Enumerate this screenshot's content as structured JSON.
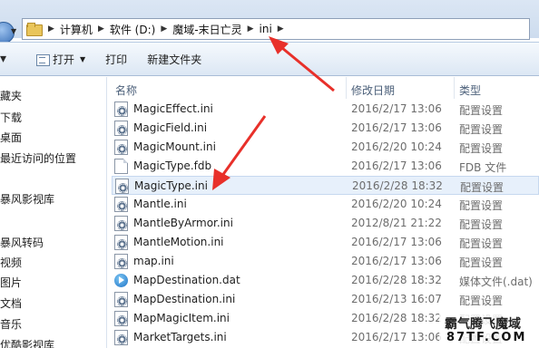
{
  "breadcrumb": {
    "items": [
      "计算机",
      "软件 (D:)",
      "魔域-末日亡灵",
      "ini"
    ]
  },
  "toolbar": {
    "open_label": "打开",
    "print_label": "打印",
    "new_folder_label": "新建文件夹"
  },
  "nav": {
    "items": [
      "藏夹",
      "下载",
      "桌面",
      "最近访问的位置",
      "",
      "暴风影视库",
      "暴风转码",
      "视频",
      "图片",
      "文档",
      "音乐",
      "优酷影视库"
    ]
  },
  "columns": {
    "name": "名称",
    "date": "修改日期",
    "type": "类型"
  },
  "files": [
    {
      "name": "MagicEffect.ini",
      "date": "2016/2/17 13:06",
      "type": "配置设置",
      "icon": "ini-file-icon"
    },
    {
      "name": "MagicField.ini",
      "date": "2016/2/17 13:06",
      "type": "配置设置",
      "icon": "ini-file-icon"
    },
    {
      "name": "MagicMount.ini",
      "date": "2016/2/20 10:24",
      "type": "配置设置",
      "icon": "ini-file-icon"
    },
    {
      "name": "MagicType.fdb",
      "date": "2016/2/17 13:06",
      "type": "FDB 文件",
      "icon": "document-icon"
    },
    {
      "name": "MagicType.ini",
      "date": "2016/2/28 18:32",
      "type": "配置设置",
      "icon": "ini-file-icon"
    },
    {
      "name": "Mantle.ini",
      "date": "2016/2/20 10:24",
      "type": "配置设置",
      "icon": "ini-file-icon"
    },
    {
      "name": "MantleByArmor.ini",
      "date": "2012/8/21 21:22",
      "type": "配置设置",
      "icon": "ini-file-icon"
    },
    {
      "name": "MantleMotion.ini",
      "date": "2016/2/17 13:06",
      "type": "配置设置",
      "icon": "ini-file-icon"
    },
    {
      "name": "map.ini",
      "date": "2016/2/17 13:06",
      "type": "配置设置",
      "icon": "ini-file-icon"
    },
    {
      "name": "MapDestination.dat",
      "date": "2016/2/28 18:32",
      "type": "媒体文件(.dat)",
      "icon": "media-file-icon"
    },
    {
      "name": "MapDestination.ini",
      "date": "2016/2/13 16:07",
      "type": "配置设置",
      "icon": "ini-file-icon"
    },
    {
      "name": "MapMagicItem.ini",
      "date": "2016/2/28 18:32",
      "type": "配置设置",
      "icon": "ini-file-icon"
    },
    {
      "name": "MarketTargets.ini",
      "date": "2016/2/17 13:06",
      "type": "配置设置",
      "icon": "ini-file-icon"
    }
  ],
  "selected_file": "MagicType.ini",
  "watermark": {
    "line1": "霸气腾飞魔域",
    "line2": "87TF.COM"
  },
  "colors": {
    "arrow": "#e8302a",
    "selection": "#e7f0fb"
  }
}
